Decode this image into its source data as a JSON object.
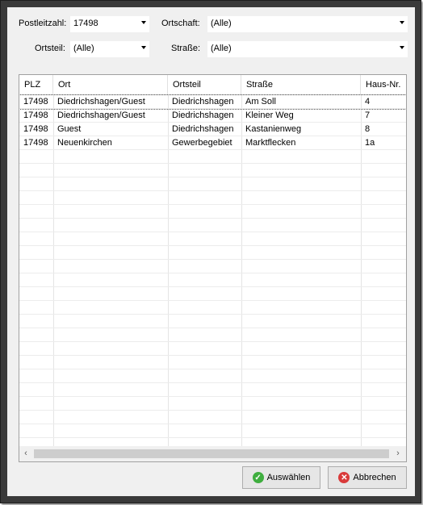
{
  "filters": {
    "postleitzahl": {
      "label": "Postleitzahl:",
      "value": "17498"
    },
    "ortschaft": {
      "label": "Ortschaft:",
      "value": "(Alle)"
    },
    "ortsteil": {
      "label": "Ortsteil:",
      "value": "(Alle)"
    },
    "strasse": {
      "label": "Straße:",
      "value": "(Alle)"
    }
  },
  "grid": {
    "columns": [
      "PLZ",
      "Ort",
      "Ortsteil",
      "Straße",
      "Haus-Nr."
    ],
    "rows": [
      [
        "17498",
        "Diedrichshagen/Guest",
        "Diedrichshagen",
        "Am Soll",
        "4"
      ],
      [
        "17498",
        "Diedrichshagen/Guest",
        "Diedrichshagen",
        "Kleiner Weg",
        "7"
      ],
      [
        "17498",
        "Guest",
        "Diedrichshagen",
        "Kastanienweg",
        "8"
      ],
      [
        "17498",
        "Neuenkirchen",
        "Gewerbegebiet",
        "Marktflecken",
        "1a"
      ]
    ]
  },
  "buttons": {
    "select_label": "Auswählen",
    "cancel_label": "Abbrechen"
  },
  "colors": {
    "select_icon": "#3fae3f",
    "cancel_icon": "#d93a3a"
  }
}
